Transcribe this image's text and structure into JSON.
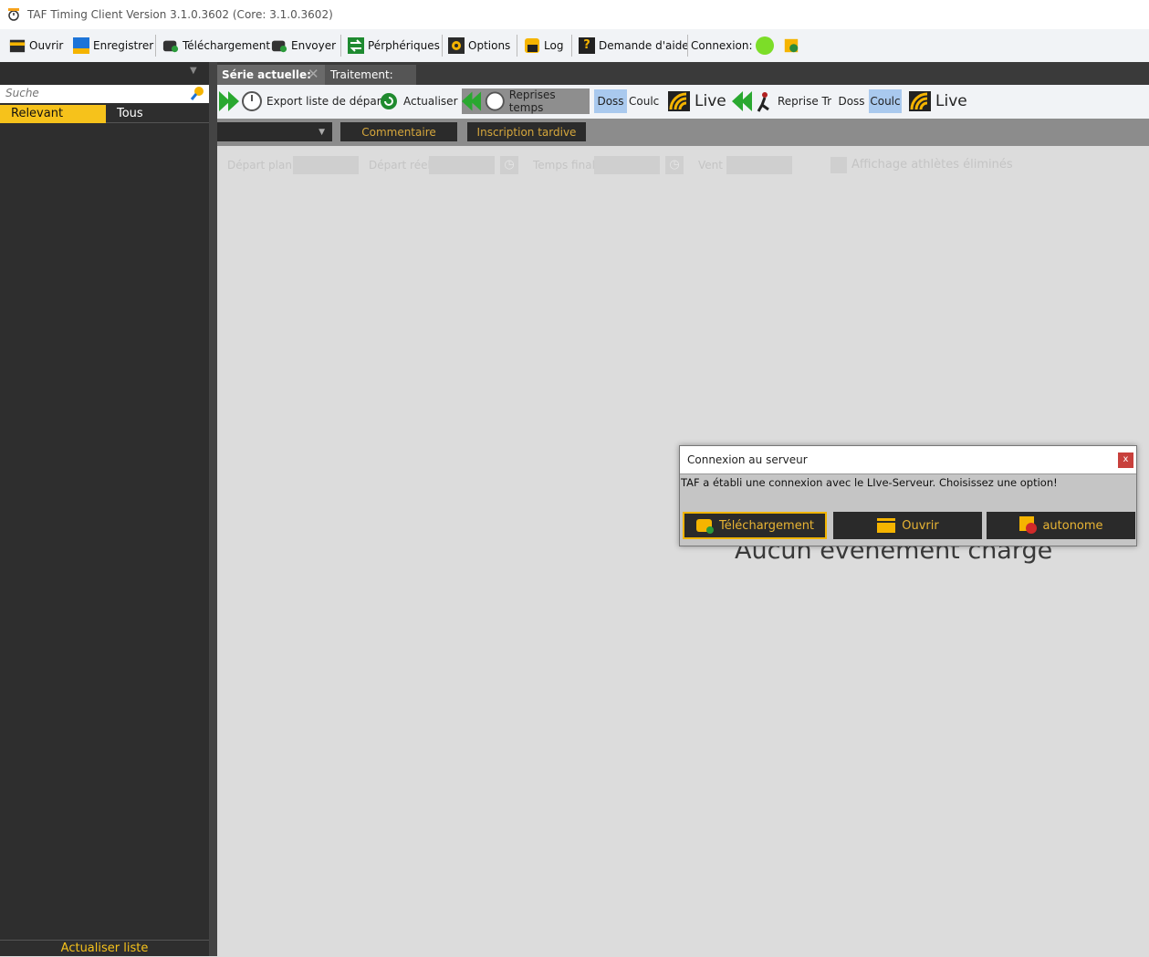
{
  "window": {
    "title": "TAF Timing Client Version 3.1.0.3602 (Core: 3.1.0.3602)"
  },
  "toolbar": {
    "open": "Ouvrir",
    "save": "Enregistrer",
    "download": "Téléchargement",
    "send": "Envoyer",
    "devices": "Pérphériques",
    "options": "Options",
    "log": "Log",
    "help": "Demande d'aide",
    "connection": "Connexion:",
    "connection_status_color": "#7cdd28"
  },
  "sidebar": {
    "search_placeholder": "Suche",
    "filter_relevant": "Relevant",
    "filter_all": "Tous",
    "refresh_list": "Actualiser liste"
  },
  "tabs": {
    "current_series": "Série actuelle:",
    "processing": "Traitement:"
  },
  "toolbar2": {
    "export_start_list": "Export liste de départ",
    "refresh": "Actualiser",
    "time_recovery": "Reprises temps",
    "bib1": "Doss",
    "lane1": "Coulc",
    "live1": "Live",
    "recovery_tr": "Reprise Tr",
    "bib2": "Doss",
    "lane2": "Coulc",
    "live2": "Live"
  },
  "actions": {
    "comment": "Commentaire",
    "late_registration": "Inscription tardive"
  },
  "fields": {
    "planned_start": "Départ plan.",
    "actual_start": "Départ réel",
    "final_time": "Temps final",
    "wind": "Vent",
    "show_eliminated": "Affichage athlètes éliminés"
  },
  "main": {
    "empty_message": "Aucun évènement chargé"
  },
  "dialog": {
    "title": "Connexion au serveur",
    "message": "TAF a établi une connexion avec le LIve-Serveur. Choisissez une option!",
    "close": "x",
    "btn_download": "Téléchargement",
    "btn_open": "Ouvrir",
    "btn_standalone": "autonome"
  },
  "colors": {
    "accent": "#f6c21b",
    "dark_panel": "#2e2e2e",
    "gray_bar": "#8c8c8c",
    "highlight_blue": "#a9c9ee"
  }
}
